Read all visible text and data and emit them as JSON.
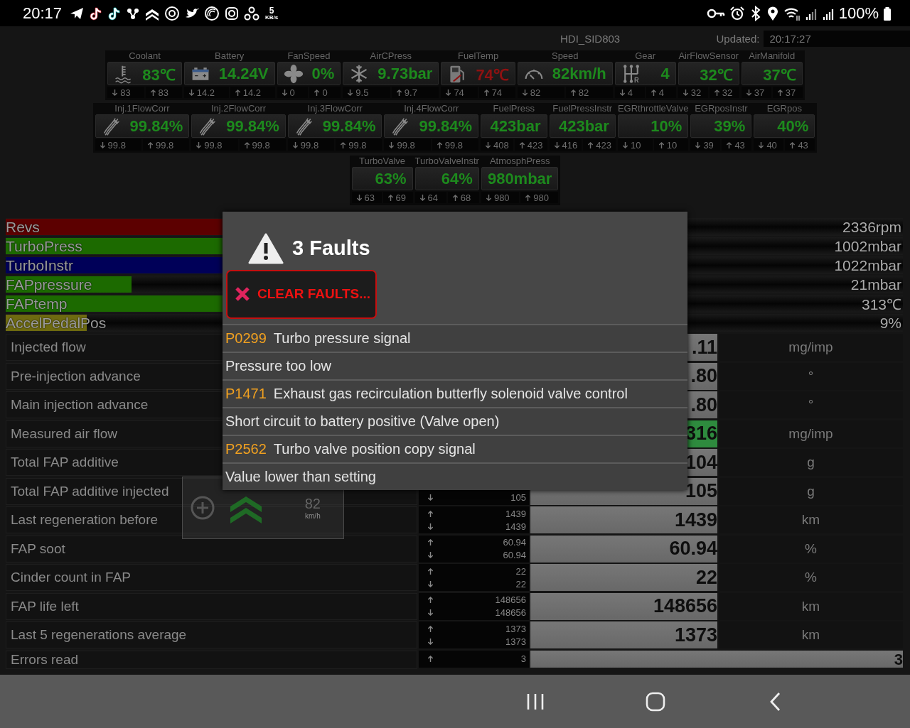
{
  "status_bar": {
    "time": "20:17",
    "net_speed": "5",
    "net_unit": "KB/s",
    "battery": "100%"
  },
  "header": {
    "profile": "HDI_SID803",
    "updated_label": "Updated:",
    "updated_time": "20:17:27"
  },
  "gauge_rows": [
    [
      {
        "kind": "thermometer",
        "label": "Coolant",
        "value": "83℃",
        "warning": false,
        "min": "83",
        "max": "83"
      },
      {
        "kind": "battery",
        "label": "Battery",
        "value": "14.24V",
        "warning": false,
        "min": "14.2",
        "max": "14.2"
      },
      {
        "kind": "fan",
        "label": "FanSpeed",
        "value": "0%",
        "warning": false,
        "min": "0",
        "max": "0"
      },
      {
        "kind": "snowflake",
        "label": "AirCPress",
        "value": "9.73bar",
        "warning": false,
        "min": "9.5",
        "max": "9.7"
      },
      {
        "kind": "fuel",
        "label": "FuelTemp",
        "value": "74℃",
        "warning": true,
        "min": "74",
        "max": "74"
      },
      {
        "kind": "speedometer",
        "label": "Speed",
        "value": "82km/h",
        "warning": false,
        "min": "82",
        "max": "82"
      },
      {
        "kind": "gearshift",
        "label": "Gear",
        "value": "4",
        "warning": false,
        "min": "4",
        "max": "4"
      },
      {
        "kind": "none",
        "label": "AirFlowSensor",
        "value": "32℃",
        "warning": false,
        "min": "32",
        "max": "32"
      },
      {
        "kind": "none",
        "label": "AirManifold",
        "value": "37℃",
        "warning": false,
        "min": "37",
        "max": "37"
      }
    ],
    [
      {
        "kind": "injector",
        "label": "Inj.1FlowCorr",
        "value": "99.84%",
        "warning": false,
        "min": "99.8",
        "max": "99.8"
      },
      {
        "kind": "injector",
        "label": "Inj.2FlowCorr",
        "value": "99.84%",
        "warning": false,
        "min": "99.8",
        "max": "99.8"
      },
      {
        "kind": "injector",
        "label": "Inj.3FlowCorr",
        "value": "99.84%",
        "warning": false,
        "min": "99.8",
        "max": "99.8"
      },
      {
        "kind": "injector",
        "label": "Inj.4FlowCorr",
        "value": "99.84%",
        "warning": false,
        "min": "99.8",
        "max": "99.8"
      },
      {
        "kind": "none",
        "label": "FuelPress",
        "value": "423bar",
        "warning": false,
        "min": "408",
        "max": "423"
      },
      {
        "kind": "none",
        "label": "FuelPressInstr",
        "value": "423bar",
        "warning": false,
        "min": "416",
        "max": "423"
      },
      {
        "kind": "none",
        "label": "EGRthrottleValve",
        "value": "10%",
        "warning": false,
        "min": "10",
        "max": "10"
      },
      {
        "kind": "none",
        "label": "EGRposInstr",
        "value": "39%",
        "warning": false,
        "min": "39",
        "max": "43"
      },
      {
        "kind": "none",
        "label": "EGRpos",
        "value": "40%",
        "warning": false,
        "min": "40",
        "max": "43"
      }
    ],
    [
      {
        "kind": "none",
        "label": "TurboValve",
        "value": "63%",
        "warning": false,
        "min": "63",
        "max": "69"
      },
      {
        "kind": "none",
        "label": "TurboValveInstr",
        "value": "64%",
        "warning": false,
        "min": "64",
        "max": "68"
      },
      {
        "kind": "none",
        "label": "AtmosphPress",
        "value": "980mbar",
        "warning": false,
        "min": "980",
        "max": "980"
      }
    ]
  ],
  "bars": [
    {
      "label": "Revs",
      "value": "2336rpm",
      "color": "#5c0000",
      "level": 0.4
    },
    {
      "label": "TurboPress",
      "value": "1002mbar",
      "color": "#1c6a00",
      "level": 0.5
    },
    {
      "label": "TurboInstr",
      "value": "1022mbar",
      "color": "#000058",
      "level": 0.5
    },
    {
      "label": "FAPpressure",
      "value": "21mbar",
      "color": "#1c6a00",
      "level": 0.14
    },
    {
      "label": "FAPtemp",
      "value": "313℃",
      "color": "#1c6a00",
      "level": 0.45
    },
    {
      "label": "AccelPedalPos",
      "value": "9%",
      "color": "#6e6a10",
      "level": 0.09
    }
  ],
  "table": {
    "rows": [
      {
        "name": "Injected flow",
        "value": ".11",
        "unit": "mg/imp",
        "highlighted": false
      },
      {
        "name": "Pre-injection advance",
        "value": ".80",
        "unit": "°",
        "highlighted": false
      },
      {
        "name": "Main injection advance",
        "value": ".80",
        "unit": "°",
        "highlighted": false
      },
      {
        "name": "Measured air flow",
        "value": "316",
        "unit": "mg/imp",
        "highlighted": true
      },
      {
        "name": "Total FAP additive",
        "value": "104",
        "unit": "g",
        "highlighted": false
      },
      {
        "name": "Total FAP additive injected",
        "low": "105",
        "value": "105",
        "unit": "g",
        "highlighted": false
      },
      {
        "name": "Last regeneration before",
        "high": "1439",
        "low": "1439",
        "value": "1439",
        "unit": "km",
        "highlighted": false
      },
      {
        "name": "FAP soot",
        "high": "60.94",
        "low": "60.94",
        "value": "60.94",
        "unit": "%",
        "highlighted": false
      },
      {
        "name": "Cinder count in FAP",
        "high": "22",
        "low": "22",
        "value": "22",
        "unit": "%",
        "highlighted": false
      },
      {
        "name": "FAP life left",
        "high": "148656",
        "low": "148656",
        "value": "148656",
        "unit": "km",
        "highlighted": false
      },
      {
        "name": "Last 5 regenerations average",
        "high": "1373",
        "low": "1373",
        "value": "1373",
        "unit": "km",
        "highlighted": false
      },
      {
        "name": "Errors read",
        "high": "3",
        "value": "3",
        "highlighted": false
      }
    ]
  },
  "speed_widget": {
    "value": "82",
    "unit": "km/h"
  },
  "faults_dialog": {
    "title": "3 Faults",
    "clear_button": "CLEAR FAULTS...",
    "faults": [
      {
        "code": "P0299",
        "description": "Turbo pressure signal",
        "detail": "Pressure too low"
      },
      {
        "code": "P1471",
        "description": "Exhaust gas recirculation butterfly solenoid valve control",
        "detail": "Short circuit to battery positive (Valve open)"
      },
      {
        "code": "P2562",
        "description": "Turbo valve position copy signal",
        "detail": "Value lower than setting"
      }
    ]
  }
}
